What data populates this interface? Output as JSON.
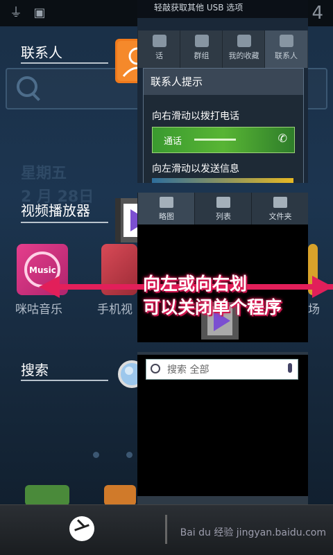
{
  "status_bar": {
    "clock_partial": "4",
    "icons": [
      "usb-icon",
      "sd-card-icon"
    ]
  },
  "recent_apps": [
    {
      "title": "联系人",
      "icon": "contacts-icon"
    },
    {
      "title": "视频播放器",
      "icon": "video-player-icon"
    },
    {
      "title": "搜索",
      "icon": "search-magnifier-icon"
    }
  ],
  "contacts_thumb": {
    "top_text": "轻敲获取其他 USB 选项",
    "tabs": [
      "话",
      "群组",
      "我的收藏",
      "联系人"
    ],
    "dialog_title": "联系人提示",
    "hint_call": "向右滑动以拨打电话",
    "call_label": "通话",
    "hint_message": "向左滑动以发送信息"
  },
  "video_thumb": {
    "tabs": [
      "略图",
      "列表",
      "文件夹"
    ]
  },
  "search_thumb": {
    "placeholder": "搜索 全部"
  },
  "wallpaper": {
    "weekday": "星期五",
    "date": "2 月 28日",
    "dock_labels": [
      "咪咕音乐",
      "手机视"
    ],
    "partial_label": "场"
  },
  "annotation": {
    "line1": "向左或向右划",
    "line2": "可以关闭单个程序"
  },
  "watermark": "Bai du 经验  jingyan.baidu.com",
  "colors": {
    "accent": "#e21f5a",
    "contacts_icon": "#f07a1c",
    "video_icon": "#7b4fd1"
  }
}
